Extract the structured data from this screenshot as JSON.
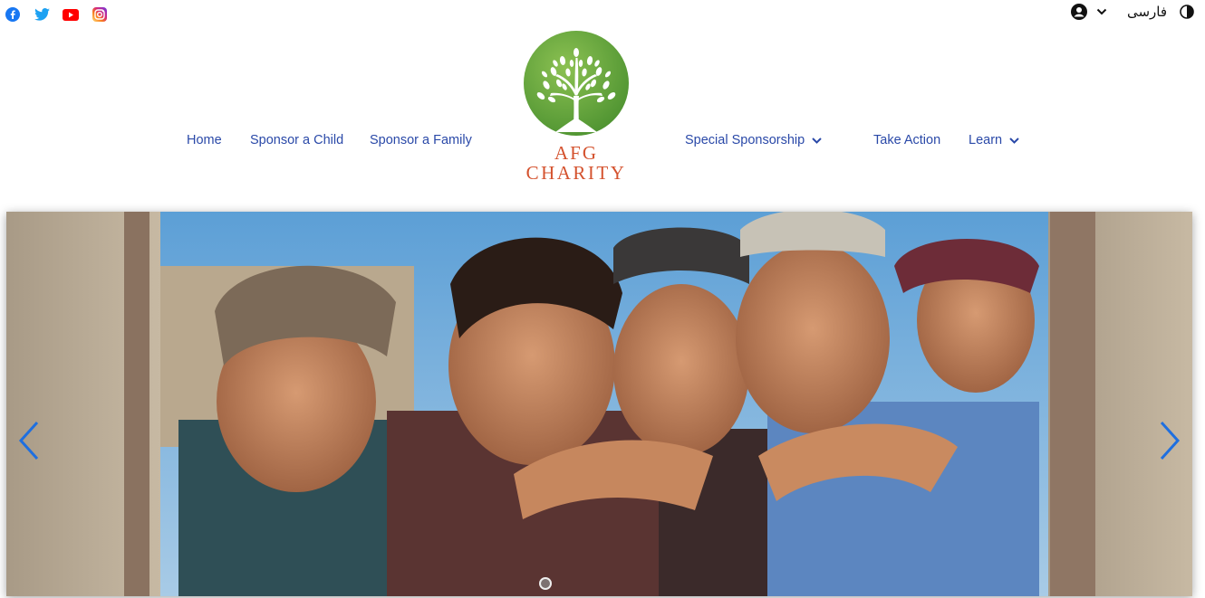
{
  "social": {
    "icons": [
      "facebook-icon",
      "twitter-icon",
      "youtube-icon",
      "instagram-icon"
    ]
  },
  "topbar": {
    "language": "فارسی",
    "icons": [
      "user-account-icon",
      "chevron-down-icon",
      "dark-mode-icon"
    ]
  },
  "nav": {
    "home": "Home",
    "sponsor_child": "Sponsor a Child",
    "sponsor_family": "Sponsor a Family",
    "special_sponsorship": "Special Sponsorship",
    "take_action": "Take Action",
    "learn": "Learn"
  },
  "logo": {
    "line1": "AFG",
    "line2": "CHARITY"
  },
  "colors": {
    "nav_link": "#2a49a8",
    "logo_text": "#d4522e",
    "logo_green": "#5a9e3a",
    "arrow": "#1e6fe0"
  }
}
